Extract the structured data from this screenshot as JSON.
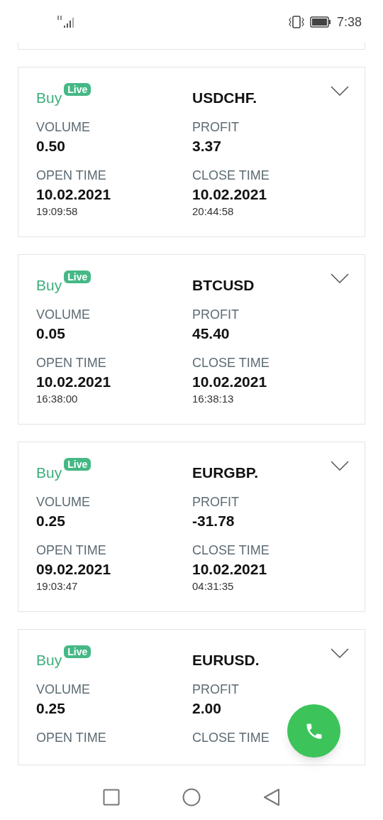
{
  "status_bar": {
    "time": "7:38"
  },
  "trades": [
    {
      "side": "Buy",
      "badge": "Live",
      "symbol": "USDCHF.",
      "expanded": false,
      "fields": [
        {
          "label": "VOLUME",
          "value": "0.50"
        },
        {
          "label": "PROFIT",
          "value": "3.37"
        },
        {
          "label": "OPEN TIME",
          "value": "10.02.2021",
          "time": "19:09:58"
        },
        {
          "label": "CLOSE TIME",
          "value": "10.02.2021",
          "time": "20:44:58"
        }
      ]
    },
    {
      "side": "Buy",
      "badge": "Live",
      "symbol": "BTCUSD",
      "expanded": false,
      "fields": [
        {
          "label": "VOLUME",
          "value": "0.05"
        },
        {
          "label": "PROFIT",
          "value": "45.40"
        },
        {
          "label": "OPEN TIME",
          "value": "10.02.2021",
          "time": "16:38:00"
        },
        {
          "label": "CLOSE TIME",
          "value": "10.02.2021",
          "time": "16:38:13"
        }
      ]
    },
    {
      "side": "Buy",
      "badge": "Live",
      "symbol": "EURGBP.",
      "expanded": false,
      "fields": [
        {
          "label": "VOLUME",
          "value": "0.25"
        },
        {
          "label": "PROFIT",
          "value": "-31.78"
        },
        {
          "label": "OPEN TIME",
          "value": "09.02.2021",
          "time": "19:03:47"
        },
        {
          "label": "CLOSE TIME",
          "value": "10.02.2021",
          "time": "04:31:35"
        }
      ]
    },
    {
      "side": "Buy",
      "badge": "Live",
      "symbol": "EURUSD.",
      "expanded": false,
      "fields": [
        {
          "label": "VOLUME",
          "value": "0.25"
        },
        {
          "label": "PROFIT",
          "value": "2.00"
        },
        {
          "label": "OPEN TIME"
        },
        {
          "label": "CLOSE TIME"
        }
      ]
    }
  ]
}
